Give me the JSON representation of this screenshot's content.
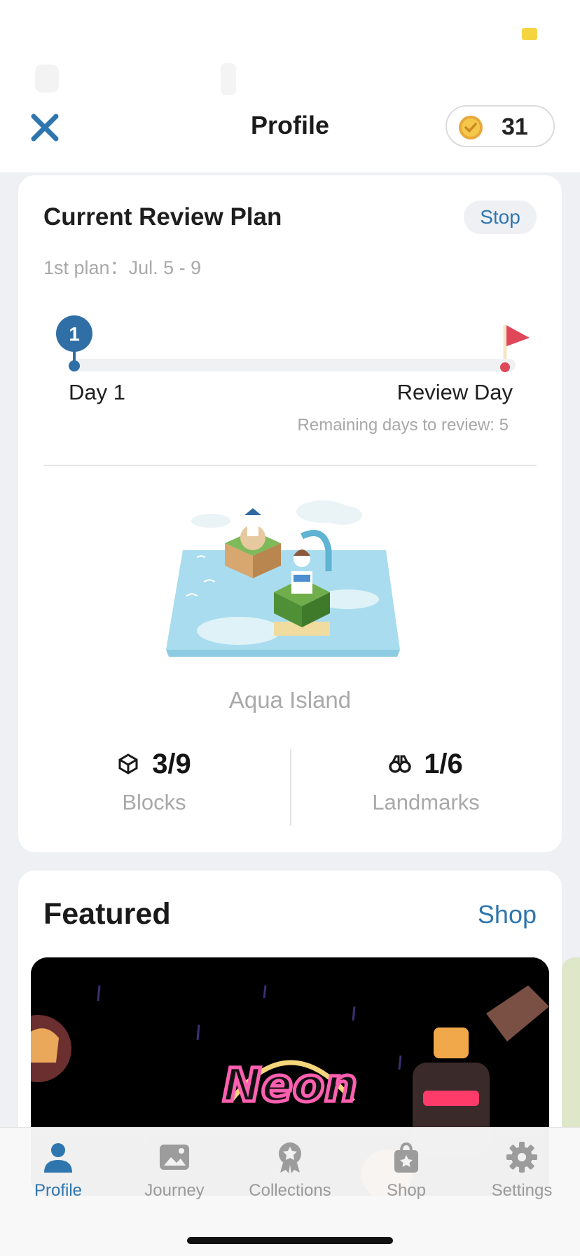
{
  "header": {
    "title": "Profile",
    "coins": "31"
  },
  "plan": {
    "title": "Current Review Plan",
    "stop_label": "Stop",
    "subtitle": "1st plan：Jul. 5 - 9",
    "current_day": "1",
    "start_label": "Day 1",
    "end_label": "Review Day",
    "remaining": "Remaining days to review: 5",
    "progress_fraction": 0.0
  },
  "island": {
    "name": "Aqua Island"
  },
  "stats": {
    "blocks_value": "3/9",
    "blocks_label": "Blocks",
    "landmarks_value": "1/6",
    "landmarks_label": "Landmarks"
  },
  "featured": {
    "title": "Featured",
    "shop_link": "Shop",
    "banner_text": "Neon"
  },
  "tabs": [
    {
      "label": "Profile",
      "icon": "person-icon",
      "active": true
    },
    {
      "label": "Journey",
      "icon": "image-icon",
      "active": false
    },
    {
      "label": "Collections",
      "icon": "badge-icon",
      "active": false
    },
    {
      "label": "Shop",
      "icon": "shopping-bag-icon",
      "active": false
    },
    {
      "label": "Settings",
      "icon": "gear-icon",
      "active": false
    }
  ],
  "colors": {
    "accent": "#2f76ae",
    "flag": "#e0485a",
    "coin": "#f2c94c"
  }
}
